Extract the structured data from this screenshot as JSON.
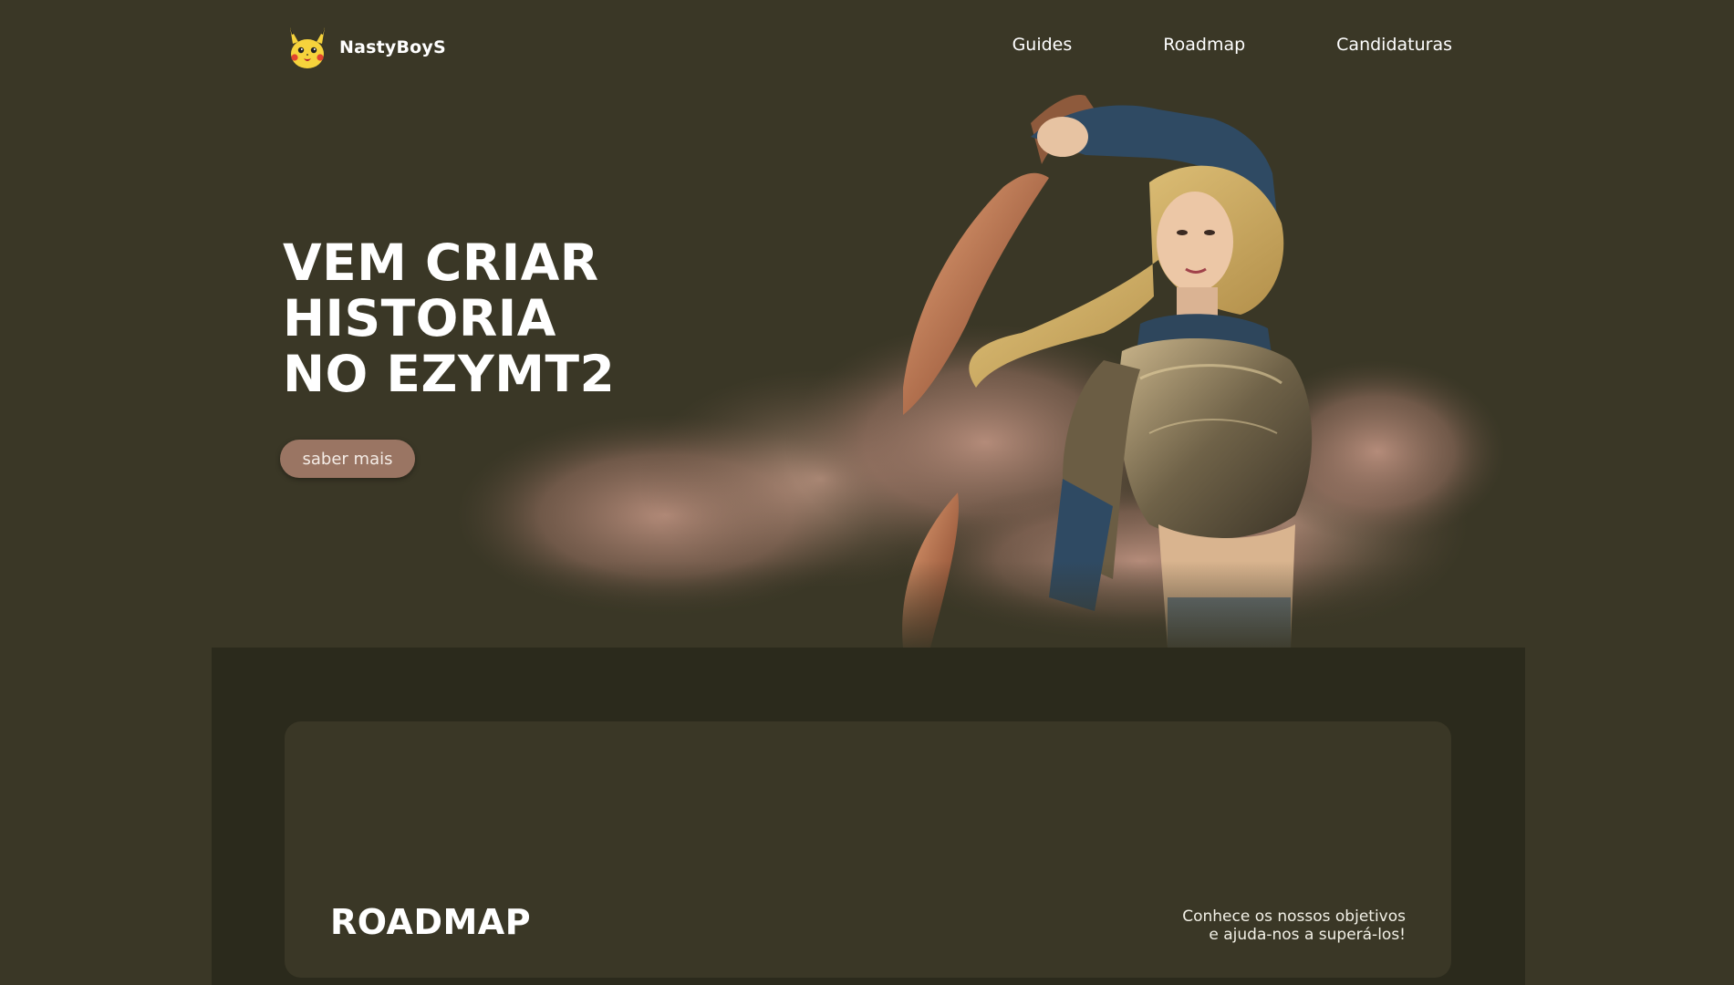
{
  "brand": {
    "name": "NastyBoyS",
    "logo_icon": "pikachu-icon"
  },
  "nav": {
    "items": [
      {
        "label": "Guides"
      },
      {
        "label": "Roadmap"
      },
      {
        "label": "Candidaturas"
      }
    ]
  },
  "hero": {
    "title_lines": [
      "VEM CRIAR",
      "HISTORIA",
      "NO EZYMT2"
    ],
    "button_label": "saber mais",
    "art": "warrior-character-illustration"
  },
  "roadmap": {
    "title": "ROADMAP",
    "description_lines": [
      "Conhece os nossos objetivos",
      "e ajuda-nos a superá-los!"
    ]
  },
  "colors": {
    "background": "#3a3726",
    "section_dark": "#2b2a1c",
    "button": "#9a7563",
    "text": "#ffffff"
  }
}
